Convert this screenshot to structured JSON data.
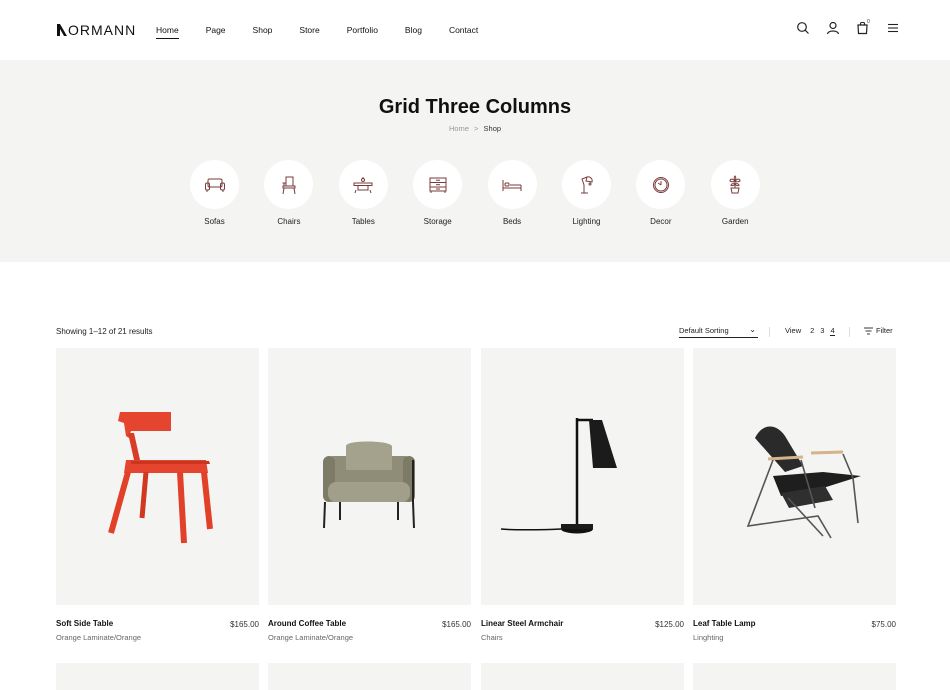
{
  "brand": {
    "name": "ORMANN"
  },
  "nav": [
    {
      "label": "Home",
      "active": true
    },
    {
      "label": "Page",
      "active": false
    },
    {
      "label": "Shop",
      "active": false
    },
    {
      "label": "Store",
      "active": false
    },
    {
      "label": "Portfolio",
      "active": false
    },
    {
      "label": "Blog",
      "active": false
    },
    {
      "label": "Contact",
      "active": false
    }
  ],
  "header_icons": [
    "search-icon",
    "user-icon",
    "cart-icon",
    "menu-icon"
  ],
  "cart_count": "0",
  "hero": {
    "title": "Grid Three Columns",
    "breadcrumb": {
      "home": "Home",
      "separator": ">",
      "current": "Shop"
    }
  },
  "categories": [
    {
      "label": "Sofas",
      "icon": "sofa-icon"
    },
    {
      "label": "Chairs",
      "icon": "chair-icon"
    },
    {
      "label": "Tables",
      "icon": "table-icon"
    },
    {
      "label": "Storage",
      "icon": "storage-icon"
    },
    {
      "label": "Beds",
      "icon": "bed-icon"
    },
    {
      "label": "Lighting",
      "icon": "lamp-icon"
    },
    {
      "label": "Decor",
      "icon": "clock-icon"
    },
    {
      "label": "Garden",
      "icon": "plant-icon"
    }
  ],
  "toolbar": {
    "results": "Showing 1–12 of 21 results",
    "sorting": "Default Sorting",
    "view_label": "View",
    "view_options": [
      "2",
      "3",
      "4"
    ],
    "view_selected": "4",
    "filter_label": "Filter"
  },
  "products": [
    {
      "name": "Soft Side Table",
      "price": "$165.00",
      "category": "Orange Laminate/Orange",
      "image": "red-chair"
    },
    {
      "name": "Around Coffee Table",
      "price": "$165.00",
      "category": "Orange Laminate/Orange",
      "image": "armchair"
    },
    {
      "name": "Linear Steel Armchair",
      "price": "$125.00",
      "category": "Chairs",
      "image": "desk-lamp"
    },
    {
      "name": "Leaf Table Lamp",
      "price": "$75.00",
      "category": "Linghting",
      "image": "lounge-chair"
    }
  ],
  "colors": {
    "hero_bg": "#f4f4f3",
    "icon_stroke": "#7a3b3b",
    "red_chair": "#e5452e",
    "armchair": "#8f8c78"
  }
}
